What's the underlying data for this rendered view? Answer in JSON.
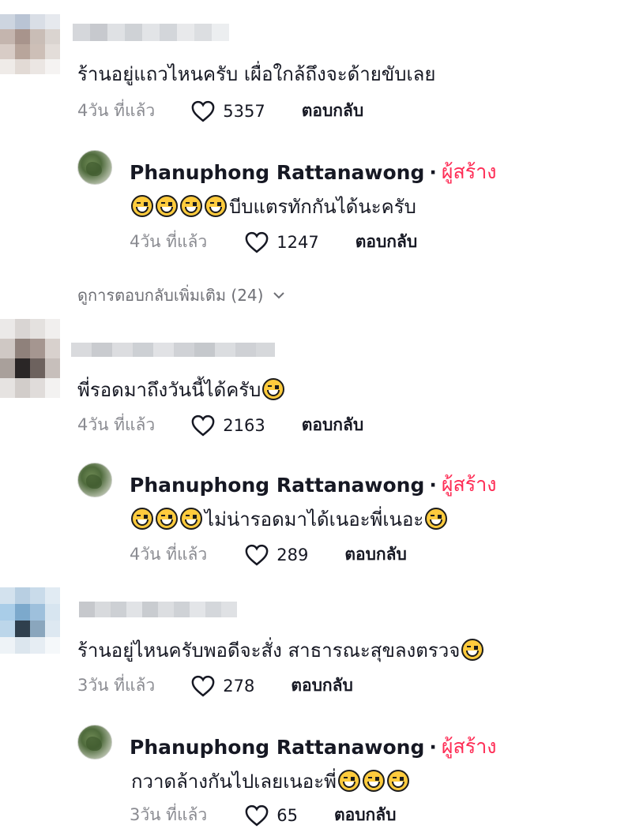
{
  "comments": [
    {
      "text": "ร้านอยู่แถวไหนครับ เผื่อใกล้ถึงจะด้ายขับเลย",
      "time": "4วัน ที่แล้ว",
      "likes": "5357",
      "reply_label": "ตอบกลับ",
      "reply": {
        "author": "Phanuphong Rattanawong",
        "separator": "·",
        "tag": "ผู้สร้าง",
        "emoji_prefix_count": 4,
        "text": "บีบแตรทักกันได้นะครับ",
        "time": "4วัน ที่แล้ว",
        "likes": "1247",
        "reply_label": "ตอบกลับ"
      },
      "more_replies": "ดูการตอบกลับเพิ่มเติม (24)"
    },
    {
      "text": "พี่รอดมาถึงวันนี้ได้ครับ",
      "time": "4วัน ที่แล้ว",
      "likes": "2163",
      "reply_label": "ตอบกลับ",
      "reply": {
        "author": "Phanuphong Rattanawong",
        "separator": "·",
        "tag": "ผู้สร้าง",
        "emoji_prefix_count": 3,
        "text": "ไม่น่ารอดมาได้เนอะพี่เนอะ",
        "time": "4วัน ที่แล้ว",
        "likes": "289",
        "reply_label": "ตอบกลับ"
      }
    },
    {
      "text": "ร้านอยู่ไหนครับพอดีจะสั่ง สาธารณะสุขลงตรวจ",
      "time": "3วัน ที่แล้ว",
      "likes": "278",
      "reply_label": "ตอบกลับ",
      "reply": {
        "author": "Phanuphong Rattanawong",
        "separator": "·",
        "tag": "ผู้สร้าง",
        "emoji_prefix_count": 0,
        "text": "กวาดล้างกันไปเลยเนอะพี่",
        "time": "3วัน ที่แล้ว",
        "likes": "65",
        "reply_label": "ตอบกลับ"
      }
    }
  ],
  "icons": {
    "like": "heart-outline-icon",
    "emoji": "grinning-sweat-emoji-icon",
    "expand": "chevron-down-icon"
  },
  "colors": {
    "creator_tag": "#fe2c55",
    "meta_gray": "#8a8b91",
    "text": "#161823"
  }
}
